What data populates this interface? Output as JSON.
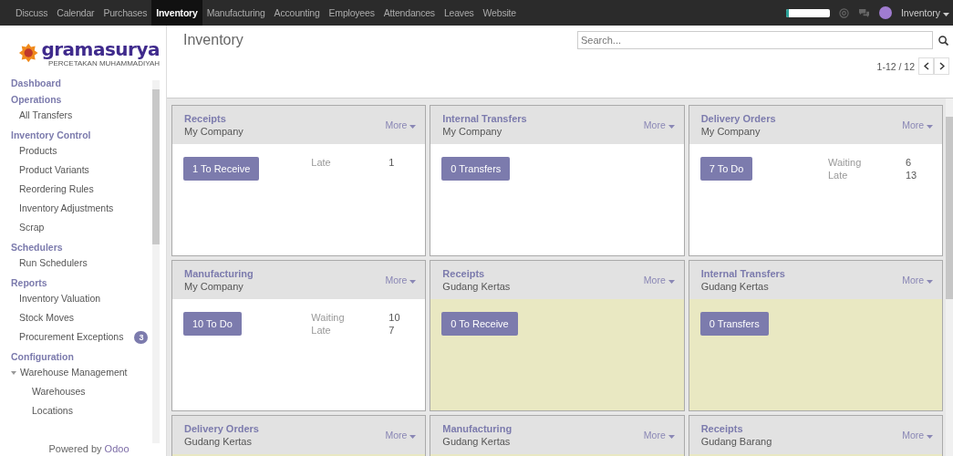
{
  "top_menu": [
    {
      "label": "Discuss",
      "selected": false
    },
    {
      "label": "Calendar",
      "selected": false
    },
    {
      "label": "Purchases",
      "selected": false
    },
    {
      "label": "Inventory",
      "selected": true
    },
    {
      "label": "Manufacturing",
      "selected": false
    },
    {
      "label": "Accounting",
      "selected": false
    },
    {
      "label": "Employees",
      "selected": false
    },
    {
      "label": "Attendances",
      "selected": false
    },
    {
      "label": "Leaves",
      "selected": false
    },
    {
      "label": "Website",
      "selected": false
    }
  ],
  "top_right": {
    "progress": {
      "level": 0.07
    },
    "user": "Inventory"
  },
  "logo": {
    "name": "gramasurya",
    "tagline": "PERCETAKAN MUHAMMADIYAH"
  },
  "sidebar": {
    "items": [
      {
        "kind": "header",
        "label": "Dashboard"
      },
      {
        "kind": "header",
        "label": "Operations"
      },
      {
        "kind": "item",
        "label": "All Transfers"
      },
      {
        "kind": "header",
        "label": "Inventory Control"
      },
      {
        "kind": "item",
        "label": "Products"
      },
      {
        "kind": "item",
        "label": "Product Variants"
      },
      {
        "kind": "item",
        "label": "Reordering Rules"
      },
      {
        "kind": "item",
        "label": "Inventory Adjustments"
      },
      {
        "kind": "item",
        "label": "Scrap"
      },
      {
        "kind": "header",
        "label": "Schedulers"
      },
      {
        "kind": "item",
        "label": "Run Schedulers"
      },
      {
        "kind": "header",
        "label": "Reports"
      },
      {
        "kind": "item",
        "label": "Inventory Valuation"
      },
      {
        "kind": "item",
        "label": "Stock Moves"
      },
      {
        "kind": "item",
        "label": "Procurement Exceptions",
        "badge": "3"
      },
      {
        "kind": "header",
        "label": "Configuration"
      },
      {
        "kind": "item",
        "label": "Warehouse Management",
        "expanded": true,
        "children": [
          {
            "kind": "item",
            "label": "Warehouses"
          },
          {
            "kind": "item",
            "label": "Locations"
          }
        ]
      }
    ],
    "footer": {
      "text": "Powered by",
      "link": "Odoo"
    }
  },
  "header": {
    "title": "Inventory",
    "search": {
      "placeholder": "Search..."
    },
    "pager": "1-12 / 12"
  },
  "cards": [
    {
      "title": "Receipts",
      "subtitle": "My Company",
      "more": "More",
      "color": "#ffffff",
      "button": "1 To Receive",
      "stats": [
        {
          "label": "Late",
          "value": "1"
        }
      ]
    },
    {
      "title": "Internal Transfers",
      "subtitle": "My Company",
      "more": "More",
      "color": "#ffffff",
      "button": "0 Transfers"
    },
    {
      "title": "Delivery Orders",
      "subtitle": "My Company",
      "more": "More",
      "color": "#ffffff",
      "button": "7 To Do",
      "stats": [
        {
          "label": "Waiting",
          "value": "6"
        },
        {
          "label": "Late",
          "value": "13"
        }
      ]
    },
    {
      "title": "Manufacturing",
      "subtitle": "My Company",
      "more": "More",
      "color": "#ffffff",
      "button": "10 To Do",
      "stats": [
        {
          "label": "Waiting",
          "value": "10"
        },
        {
          "label": "Late",
          "value": "7"
        }
      ]
    },
    {
      "title": "Receipts",
      "subtitle": "Gudang Kertas",
      "more": "More",
      "color": "#e9e8c2",
      "button": "0 To Receive"
    },
    {
      "title": "Internal Transfers",
      "subtitle": "Gudang Kertas",
      "more": "More",
      "color": "#e9e8c2",
      "button": "0 Transfers"
    },
    {
      "title": "Delivery Orders",
      "subtitle": "Gudang Kertas",
      "more": "More",
      "color": "#e9e8c2"
    },
    {
      "title": "Manufacturing",
      "subtitle": "Gudang Kertas",
      "more": "More",
      "color": "#e9e8c2"
    },
    {
      "title": "Receipts",
      "subtitle": "Gudang Barang",
      "more": "More",
      "color": "#e9e8c2"
    }
  ]
}
